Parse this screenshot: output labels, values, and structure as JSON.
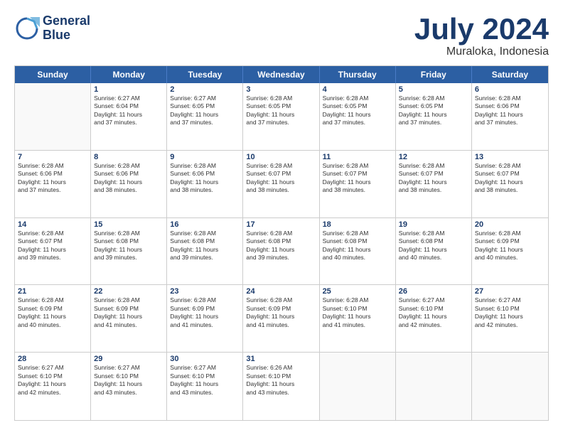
{
  "header": {
    "logo_line1": "General",
    "logo_line2": "Blue",
    "month": "July 2024",
    "location": "Muraloka, Indonesia"
  },
  "weekdays": [
    "Sunday",
    "Monday",
    "Tuesday",
    "Wednesday",
    "Thursday",
    "Friday",
    "Saturday"
  ],
  "weeks": [
    [
      {
        "day": "",
        "info": ""
      },
      {
        "day": "1",
        "info": "Sunrise: 6:27 AM\nSunset: 6:04 PM\nDaylight: 11 hours\nand 37 minutes."
      },
      {
        "day": "2",
        "info": "Sunrise: 6:27 AM\nSunset: 6:05 PM\nDaylight: 11 hours\nand 37 minutes."
      },
      {
        "day": "3",
        "info": "Sunrise: 6:28 AM\nSunset: 6:05 PM\nDaylight: 11 hours\nand 37 minutes."
      },
      {
        "day": "4",
        "info": "Sunrise: 6:28 AM\nSunset: 6:05 PM\nDaylight: 11 hours\nand 37 minutes."
      },
      {
        "day": "5",
        "info": "Sunrise: 6:28 AM\nSunset: 6:05 PM\nDaylight: 11 hours\nand 37 minutes."
      },
      {
        "day": "6",
        "info": "Sunrise: 6:28 AM\nSunset: 6:06 PM\nDaylight: 11 hours\nand 37 minutes."
      }
    ],
    [
      {
        "day": "7",
        "info": "Sunrise: 6:28 AM\nSunset: 6:06 PM\nDaylight: 11 hours\nand 37 minutes."
      },
      {
        "day": "8",
        "info": "Sunrise: 6:28 AM\nSunset: 6:06 PM\nDaylight: 11 hours\nand 38 minutes."
      },
      {
        "day": "9",
        "info": "Sunrise: 6:28 AM\nSunset: 6:06 PM\nDaylight: 11 hours\nand 38 minutes."
      },
      {
        "day": "10",
        "info": "Sunrise: 6:28 AM\nSunset: 6:07 PM\nDaylight: 11 hours\nand 38 minutes."
      },
      {
        "day": "11",
        "info": "Sunrise: 6:28 AM\nSunset: 6:07 PM\nDaylight: 11 hours\nand 38 minutes."
      },
      {
        "day": "12",
        "info": "Sunrise: 6:28 AM\nSunset: 6:07 PM\nDaylight: 11 hours\nand 38 minutes."
      },
      {
        "day": "13",
        "info": "Sunrise: 6:28 AM\nSunset: 6:07 PM\nDaylight: 11 hours\nand 38 minutes."
      }
    ],
    [
      {
        "day": "14",
        "info": "Sunrise: 6:28 AM\nSunset: 6:07 PM\nDaylight: 11 hours\nand 39 minutes."
      },
      {
        "day": "15",
        "info": "Sunrise: 6:28 AM\nSunset: 6:08 PM\nDaylight: 11 hours\nand 39 minutes."
      },
      {
        "day": "16",
        "info": "Sunrise: 6:28 AM\nSunset: 6:08 PM\nDaylight: 11 hours\nand 39 minutes."
      },
      {
        "day": "17",
        "info": "Sunrise: 6:28 AM\nSunset: 6:08 PM\nDaylight: 11 hours\nand 39 minutes."
      },
      {
        "day": "18",
        "info": "Sunrise: 6:28 AM\nSunset: 6:08 PM\nDaylight: 11 hours\nand 40 minutes."
      },
      {
        "day": "19",
        "info": "Sunrise: 6:28 AM\nSunset: 6:08 PM\nDaylight: 11 hours\nand 40 minutes."
      },
      {
        "day": "20",
        "info": "Sunrise: 6:28 AM\nSunset: 6:09 PM\nDaylight: 11 hours\nand 40 minutes."
      }
    ],
    [
      {
        "day": "21",
        "info": "Sunrise: 6:28 AM\nSunset: 6:09 PM\nDaylight: 11 hours\nand 40 minutes."
      },
      {
        "day": "22",
        "info": "Sunrise: 6:28 AM\nSunset: 6:09 PM\nDaylight: 11 hours\nand 41 minutes."
      },
      {
        "day": "23",
        "info": "Sunrise: 6:28 AM\nSunset: 6:09 PM\nDaylight: 11 hours\nand 41 minutes."
      },
      {
        "day": "24",
        "info": "Sunrise: 6:28 AM\nSunset: 6:09 PM\nDaylight: 11 hours\nand 41 minutes."
      },
      {
        "day": "25",
        "info": "Sunrise: 6:28 AM\nSunset: 6:10 PM\nDaylight: 11 hours\nand 41 minutes."
      },
      {
        "day": "26",
        "info": "Sunrise: 6:27 AM\nSunset: 6:10 PM\nDaylight: 11 hours\nand 42 minutes."
      },
      {
        "day": "27",
        "info": "Sunrise: 6:27 AM\nSunset: 6:10 PM\nDaylight: 11 hours\nand 42 minutes."
      }
    ],
    [
      {
        "day": "28",
        "info": "Sunrise: 6:27 AM\nSunset: 6:10 PM\nDaylight: 11 hours\nand 42 minutes."
      },
      {
        "day": "29",
        "info": "Sunrise: 6:27 AM\nSunset: 6:10 PM\nDaylight: 11 hours\nand 43 minutes."
      },
      {
        "day": "30",
        "info": "Sunrise: 6:27 AM\nSunset: 6:10 PM\nDaylight: 11 hours\nand 43 minutes."
      },
      {
        "day": "31",
        "info": "Sunrise: 6:26 AM\nSunset: 6:10 PM\nDaylight: 11 hours\nand 43 minutes."
      },
      {
        "day": "",
        "info": ""
      },
      {
        "day": "",
        "info": ""
      },
      {
        "day": "",
        "info": ""
      }
    ]
  ]
}
